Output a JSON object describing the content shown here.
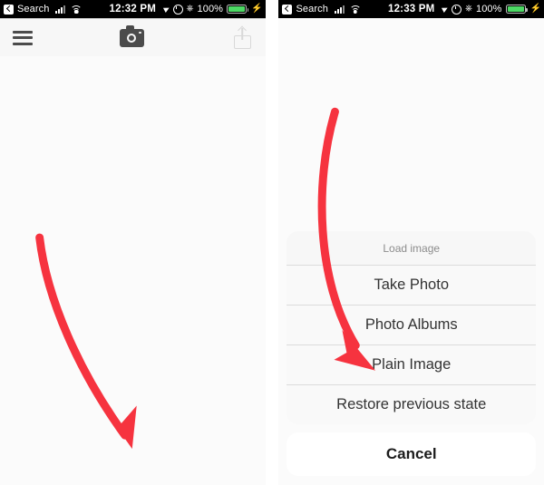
{
  "left_screen": {
    "status_bar": {
      "back_label": "Search",
      "time": "12:32 PM",
      "battery_percent": "100%",
      "icons": [
        "back-chevron-icon",
        "cellular-signal-icon",
        "wifi-icon",
        "location-arrow-icon",
        "alarm-clock-icon",
        "bluetooth-icon",
        "battery-icon",
        "charging-bolt-icon"
      ]
    },
    "toolbar": {
      "menu_label": "menu",
      "camera_label": "camera",
      "share_label": "share"
    },
    "annotation": {
      "type": "curved-arrow",
      "color": "#F6333F",
      "points_to": "camera-button"
    }
  },
  "right_screen": {
    "status_bar": {
      "back_label": "Search",
      "time": "12:33 PM",
      "battery_percent": "100%",
      "icons": [
        "back-chevron-icon",
        "cellular-signal-icon",
        "wifi-icon",
        "location-arrow-icon",
        "alarm-clock-icon",
        "bluetooth-icon",
        "battery-icon",
        "charging-bolt-icon"
      ]
    },
    "action_sheet": {
      "title": "Load image",
      "options": [
        "Take Photo",
        "Photo Albums",
        "Plain Image",
        "Restore previous state"
      ],
      "cancel_label": "Cancel"
    },
    "annotation": {
      "type": "curved-arrow",
      "color": "#F6333F",
      "points_to": "Plain Image"
    }
  },
  "colors": {
    "accent_red": "#F6333F",
    "battery_green": "#4cd964",
    "status_bar_bg": "#000000",
    "canvas_bg": "#fbfbfb",
    "grid_line": "#e7e7e7",
    "dim_overlay": "#5a5a5a"
  }
}
